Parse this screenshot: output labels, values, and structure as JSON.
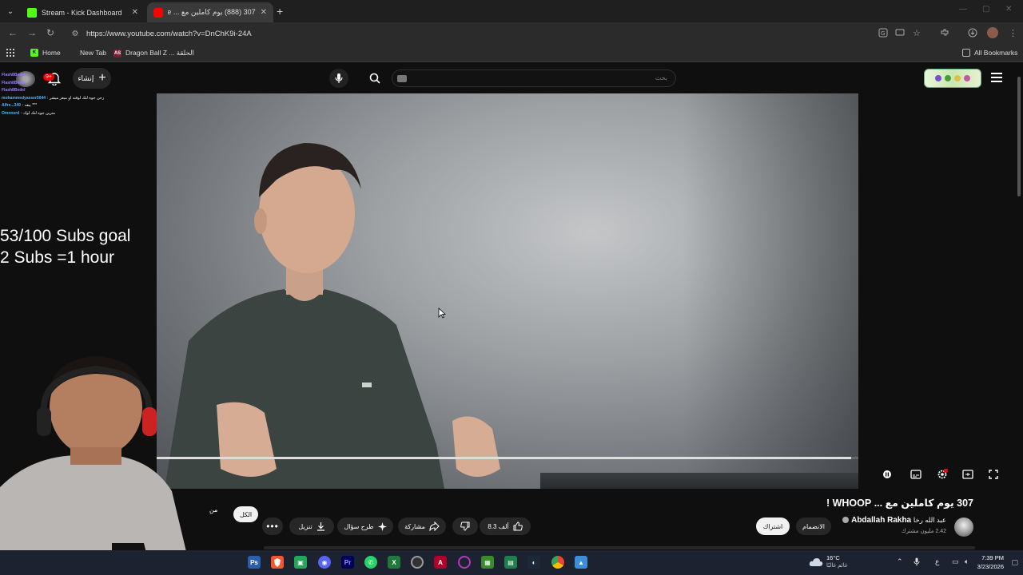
{
  "browser": {
    "tabs": [
      {
        "title": "Stream - Kick Dashboard",
        "favicon": "kick-icon",
        "active": false
      },
      {
        "title": "307 (888) يوم كاملين مع ... Tube",
        "favicon": "youtube-icon",
        "active": true
      }
    ],
    "url": "https://www.youtube.com/watch?v=DnChK9i-24A",
    "bookmarks": [
      {
        "label": "Home",
        "icon": "kick-icon"
      },
      {
        "label": "New Tab",
        "icon": ""
      },
      {
        "label": "Dragon Ball Z ... الحلقة",
        "icon": "as-icon"
      }
    ],
    "all_bookmarks": "All Bookmarks"
  },
  "youtube": {
    "search_placeholder": "بحث",
    "create_label": "إنشاء",
    "notifications_badge": "9+",
    "video_progress_fraction": 0.99
  },
  "overlay": {
    "chat": [
      {
        "user": "Flash8Bedel",
        "text": ""
      },
      {
        "user": "Flash8Bedel",
        "text": ""
      },
      {
        "user": "Flash8Bedel",
        "text": ""
      },
      {
        "user": "mohammedyasser5644",
        "text": ": رحن جوه لنك لوقته او ميعز ميشر"
      },
      {
        "user": "Alfre...349",
        "text": ": يبقه ***"
      },
      {
        "user": "Omnnerd",
        "text": ": مترين جوه لنك لوك"
      }
    ],
    "goal_line1": "53/100 Subs goal",
    "goal_line2": "2 Subs =1 hour"
  },
  "video_meta": {
    "title": "307 يوم كاملين مع ... WHOOP !",
    "channel_name": "Abdallah Rakha",
    "channel_name_ar": "عبد الله رخا",
    "subscribers": "2.42 مليون مشترك",
    "subscribe_label": "اشتراك",
    "join_label": "الانضمام",
    "like_count": "8.3 ألف",
    "share_label": "مشاركة",
    "ask_label": "طرح سؤال",
    "download_label": "تنزيل",
    "chip_all": "الكل",
    "chip_from": "من"
  },
  "taskbar": {
    "weather_temp": "16°C",
    "weather_condition": "غائم غالبًا",
    "lang": "ع",
    "time": "7:39 PM",
    "date": "3/23/2026"
  }
}
